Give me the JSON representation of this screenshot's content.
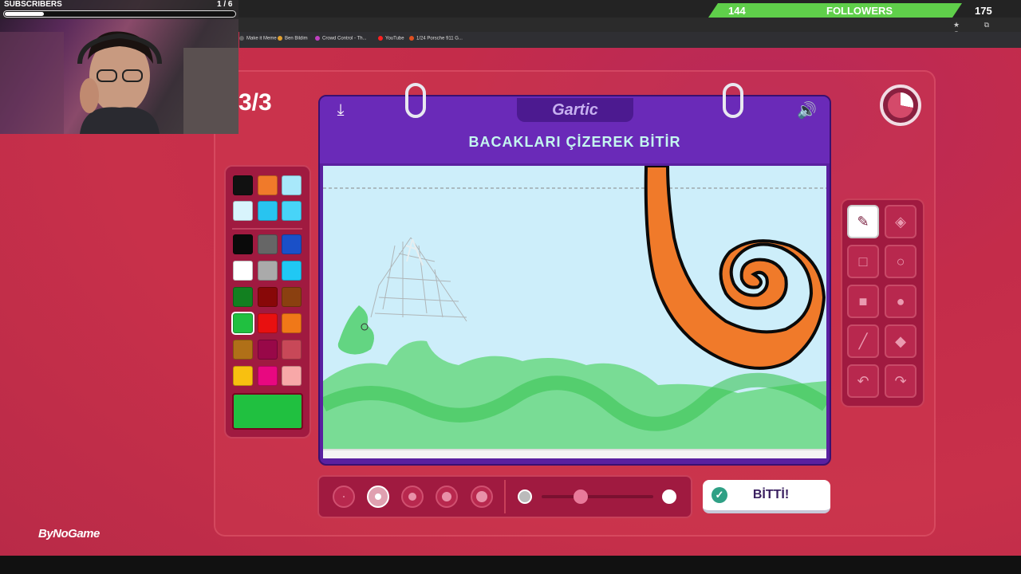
{
  "overlay": {
    "subscribers_label": "SUBSCRIBERS",
    "subscribers_count": "1 / 6",
    "subscribers_progress": 0.17,
    "followers_count": "144",
    "followers_label": "FOLLOWERS",
    "followers_goal": "175"
  },
  "bookmarks": [
    {
      "label": "Make it Meme",
      "icon": "meme-icon",
      "color": "#666"
    },
    {
      "label": "Ben Bildim",
      "icon": "bookmark-icon",
      "color": "#e0a030"
    },
    {
      "label": "Crowd Control - Th...",
      "icon": "crowd-control-icon",
      "color": "#c040c0"
    },
    {
      "label": "YouTube",
      "icon": "youtube-icon",
      "color": "#ff2020"
    },
    {
      "label": "1/24 Porsche 911 G...",
      "icon": "porsche-icon",
      "color": "#e05020"
    }
  ],
  "game": {
    "round": "3/3",
    "logo": "Gartic",
    "prompt": "BACAKLARI ÇİZEREK BİTİR",
    "done_label": "BİTTİ!",
    "brand": "ByNoGame",
    "timer_remaining_fraction": 0.28
  },
  "palette": {
    "top_row": [
      "#111111",
      "#f07a2a",
      "#a8e8fa",
      "#d8f4fc",
      "#28c4f0",
      "#48d4f8"
    ],
    "colors": [
      "#0a0a0a",
      "#666666",
      "#1a50c8",
      "#ffffff",
      "#aaaaaa",
      "#20c8f4",
      "#128020",
      "#880808",
      "#8a4010",
      "#20c040",
      "#e81010",
      "#f07818",
      "#b07018",
      "#980848",
      "#c84858",
      "#f8c010",
      "#e80880",
      "#f8a8a8"
    ],
    "selected_color": "#20c040"
  },
  "tools": [
    {
      "name": "pencil-tool",
      "icon": "✎",
      "active": true
    },
    {
      "name": "eraser-tool",
      "icon": "◈",
      "active": false
    },
    {
      "name": "rectangle-outline-tool",
      "icon": "□",
      "active": false
    },
    {
      "name": "circle-outline-tool",
      "icon": "○",
      "active": false
    },
    {
      "name": "rectangle-fill-tool",
      "icon": "■",
      "active": false
    },
    {
      "name": "circle-fill-tool",
      "icon": "●",
      "active": false
    },
    {
      "name": "line-tool",
      "icon": "╱",
      "active": false
    },
    {
      "name": "fill-bucket-tool",
      "icon": "◆",
      "active": false
    },
    {
      "name": "undo-tool",
      "icon": "↶",
      "active": false
    },
    {
      "name": "redo-tool",
      "icon": "↷",
      "active": false
    }
  ],
  "brush": {
    "sizes": 5,
    "selected_size_index": 1,
    "opacity_level": 0.35
  },
  "icons": {
    "download": "⤓",
    "sound": "🔊",
    "check": "✓"
  }
}
